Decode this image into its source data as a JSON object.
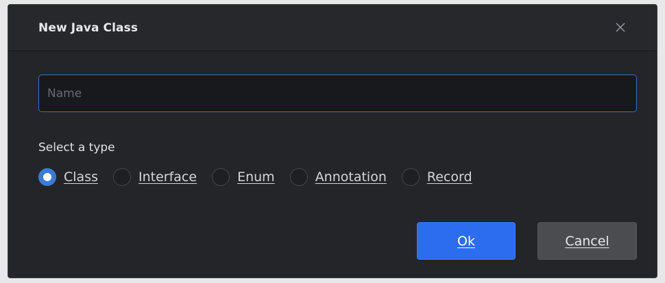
{
  "dialog": {
    "title": "New Java Class",
    "close_icon": "close-icon"
  },
  "name_field": {
    "value": "",
    "placeholder": "Name"
  },
  "type_section": {
    "label": "Select a type",
    "selected": "Class",
    "options": [
      {
        "label": "Class",
        "checked": true
      },
      {
        "label": "Interface",
        "checked": false
      },
      {
        "label": "Enum",
        "checked": false
      },
      {
        "label": "Annotation",
        "checked": false
      },
      {
        "label": "Record",
        "checked": false
      }
    ]
  },
  "buttons": {
    "ok_label": "Ok",
    "cancel_label": "Cancel"
  },
  "colors": {
    "dialog_bg": "#242529",
    "accent": "#2c6df0",
    "input_border": "#3b6fc4",
    "cancel_bg": "#4b4c50"
  }
}
